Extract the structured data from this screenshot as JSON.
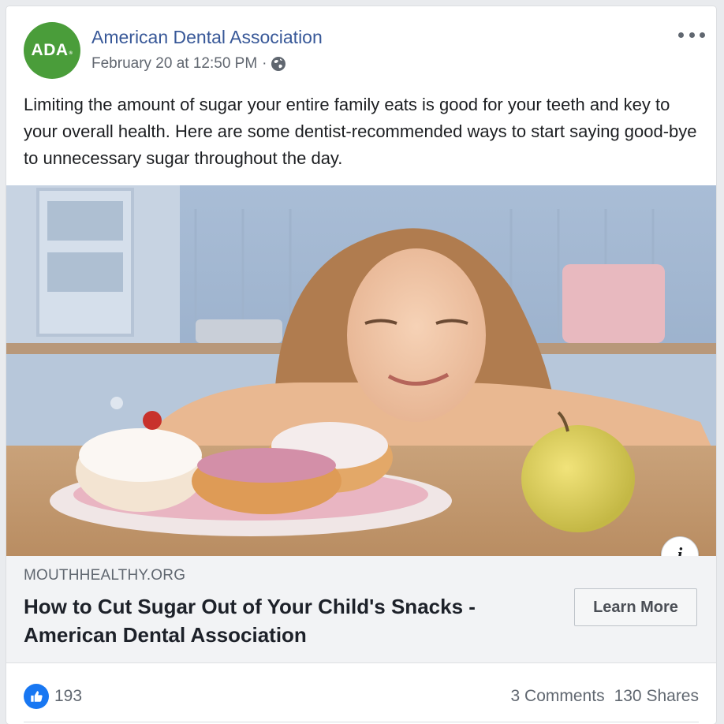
{
  "post": {
    "avatar_text": "ADA",
    "avatar_mark": "®",
    "page_name": "American Dental Association",
    "timestamp": "February 20 at 12:50 PM",
    "separator": "·",
    "privacy_icon": "globe-icon",
    "more_icon": "ellipsis-icon",
    "text": "Limiting the amount of sugar your entire family eats is good for your teeth and key to your overall health. Here are some dentist-recommended ways to start saying good-bye to unnecessary sugar throughout the day."
  },
  "link_preview": {
    "info_icon": "i",
    "domain": "MOUTHHEALTHY.ORG",
    "title": "How to Cut Sugar Out of Your Child's Snacks - American Dental Association",
    "cta_label": "Learn More"
  },
  "engagement": {
    "like_icon": "thumbs-up-icon",
    "likes": "193",
    "comments": "3 Comments",
    "shares": "130 Shares"
  },
  "colors": {
    "brand_green": "#4a9d3a",
    "link_blue": "#385898",
    "like_blue": "#1877f2"
  }
}
